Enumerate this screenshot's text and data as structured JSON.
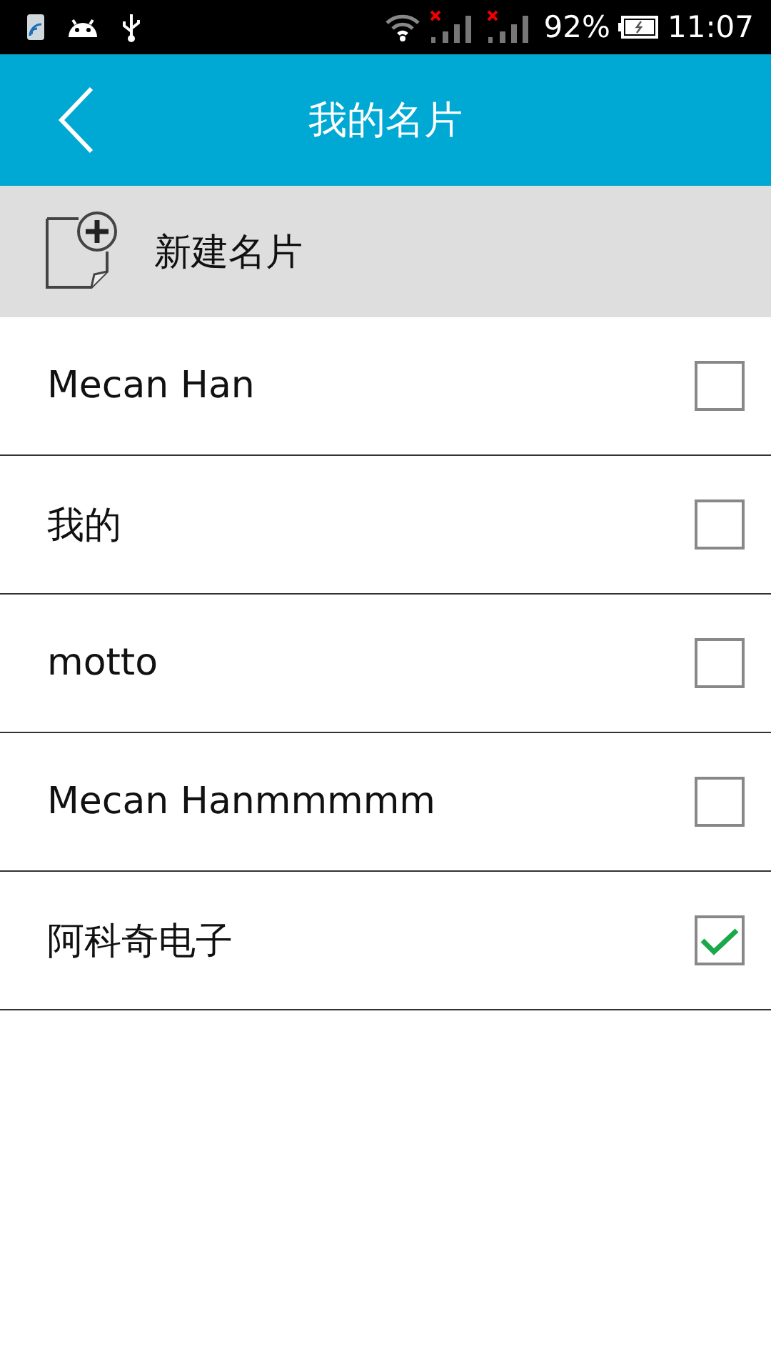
{
  "status_bar": {
    "battery": "92%",
    "time": "11:07"
  },
  "header": {
    "title": "我的名片"
  },
  "new_card": {
    "label": "新建名片"
  },
  "cards": [
    {
      "name": "Mecan Han",
      "checked": false
    },
    {
      "name": "我的",
      "checked": false
    },
    {
      "name": "motto",
      "checked": false
    },
    {
      "name": "Mecan Hanmmmmm",
      "checked": false
    },
    {
      "name": "阿科奇电子",
      "checked": true
    }
  ]
}
